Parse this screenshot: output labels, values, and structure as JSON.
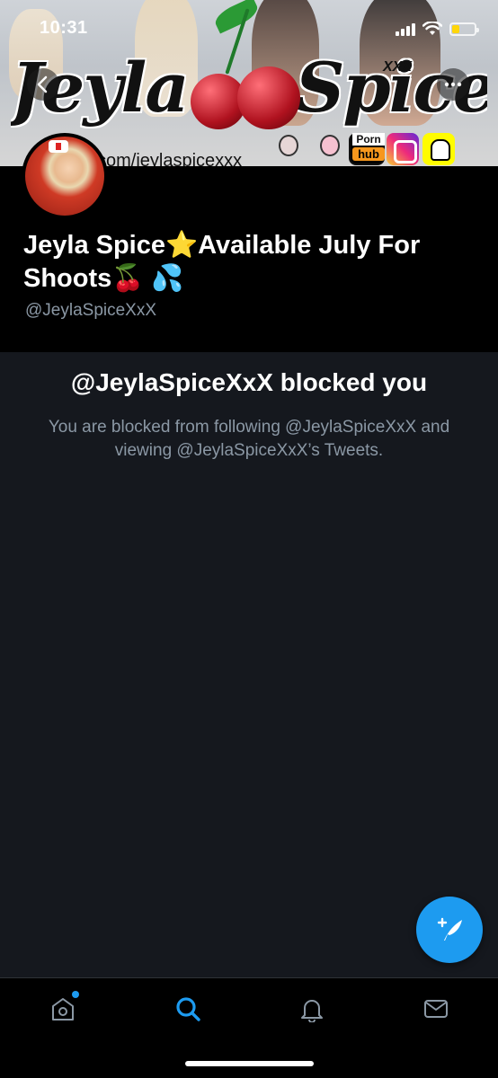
{
  "status_bar": {
    "time": "10:31",
    "battery_level": 0.35,
    "battery_color": "#ffd60a"
  },
  "banner": {
    "logo_text_left": "Jeyla",
    "logo_text_right": "Spice",
    "xxx_text": "XXX",
    "url_text": "com/jeylaspicexxx",
    "pornhub_top": "Porn",
    "pornhub_bottom": "hub",
    "social_icons": [
      "onlyfans-icon",
      "manyvids-icon",
      "pornhub-logo",
      "instagram-icon",
      "snapchat-icon"
    ]
  },
  "nav": {
    "back_icon": "chevron-left-icon",
    "more_icon": "ellipsis-icon"
  },
  "profile": {
    "display_name": "Jeyla Spice⭐Available July For Shoots🍒 💦",
    "handle": "@JeylaSpiceXxX"
  },
  "blocked": {
    "title": "@JeylaSpiceXxX blocked you",
    "description": "You are blocked from following @JeylaSpiceXxX and viewing @JeylaSpiceXxX’s Tweets."
  },
  "fab": {
    "icon": "compose-tweet-icon",
    "color": "#1d9bf0"
  },
  "tabbar": {
    "items": [
      {
        "name": "home",
        "icon": "home-icon",
        "active": false,
        "has_dot": true
      },
      {
        "name": "search",
        "icon": "search-icon",
        "active": true
      },
      {
        "name": "notifications",
        "icon": "bell-icon",
        "active": false
      },
      {
        "name": "messages",
        "icon": "envelope-icon",
        "active": false
      }
    ],
    "accent": "#1d9bf0",
    "inactive": "#8b98a5"
  }
}
